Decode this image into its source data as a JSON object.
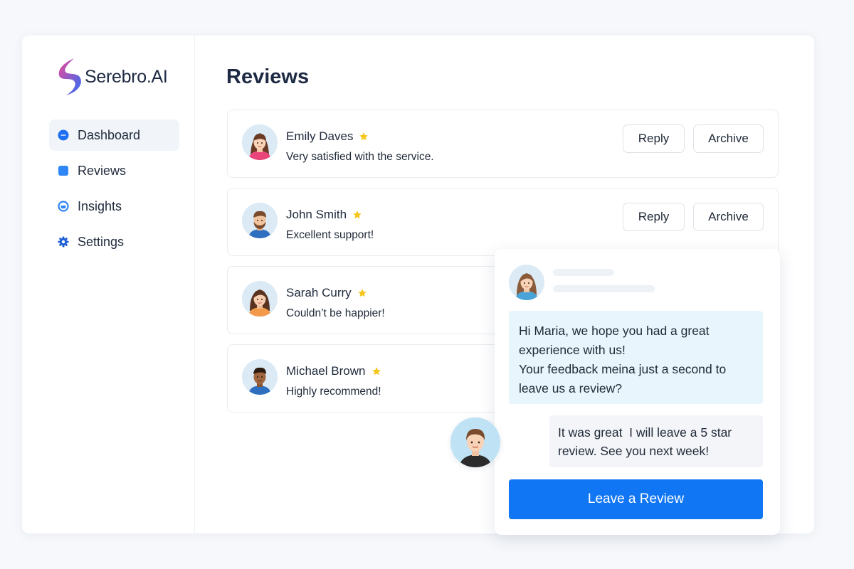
{
  "brand": {
    "name": "Serebro.AI",
    "icon": "brand-logo-icon",
    "gradient": [
      "#ec4899",
      "#3b82f6"
    ]
  },
  "nav": {
    "items": [
      {
        "label": "Dashboard",
        "icon": "dashboard-icon",
        "active": true
      },
      {
        "label": "Reviews",
        "icon": "reviews-icon",
        "active": false
      },
      {
        "label": "Insights",
        "icon": "insights-icon",
        "active": false
      },
      {
        "label": "Settings",
        "icon": "settings-icon",
        "active": false
      }
    ]
  },
  "page": {
    "title": "Reviews"
  },
  "reviews": [
    {
      "name": "Emily Daves",
      "text": "Very satisfied with the service.",
      "reply_label": "Reply",
      "archive_label": "Archive"
    },
    {
      "name": "John Smith",
      "text": "Excellent support!",
      "reply_label": "Reply",
      "archive_label": "Archive"
    },
    {
      "name": "Sarah Curry",
      "text": "Couldn’t be happier!"
    },
    {
      "name": "Michael Brown",
      "text": "Highly recommend!"
    }
  ],
  "chat": {
    "incoming_message": "Hi Maria, we hope you had a great experience with us!\nYour feedback meina just a second to leave us a review?",
    "outgoing_message": "It was great  I will leave a 5 star review. See you next week!",
    "cta_label": "Leave a Review"
  },
  "colors": {
    "accent": "#1176f4",
    "star": "#f5c518",
    "nav_icon": "#1e6ff2"
  }
}
